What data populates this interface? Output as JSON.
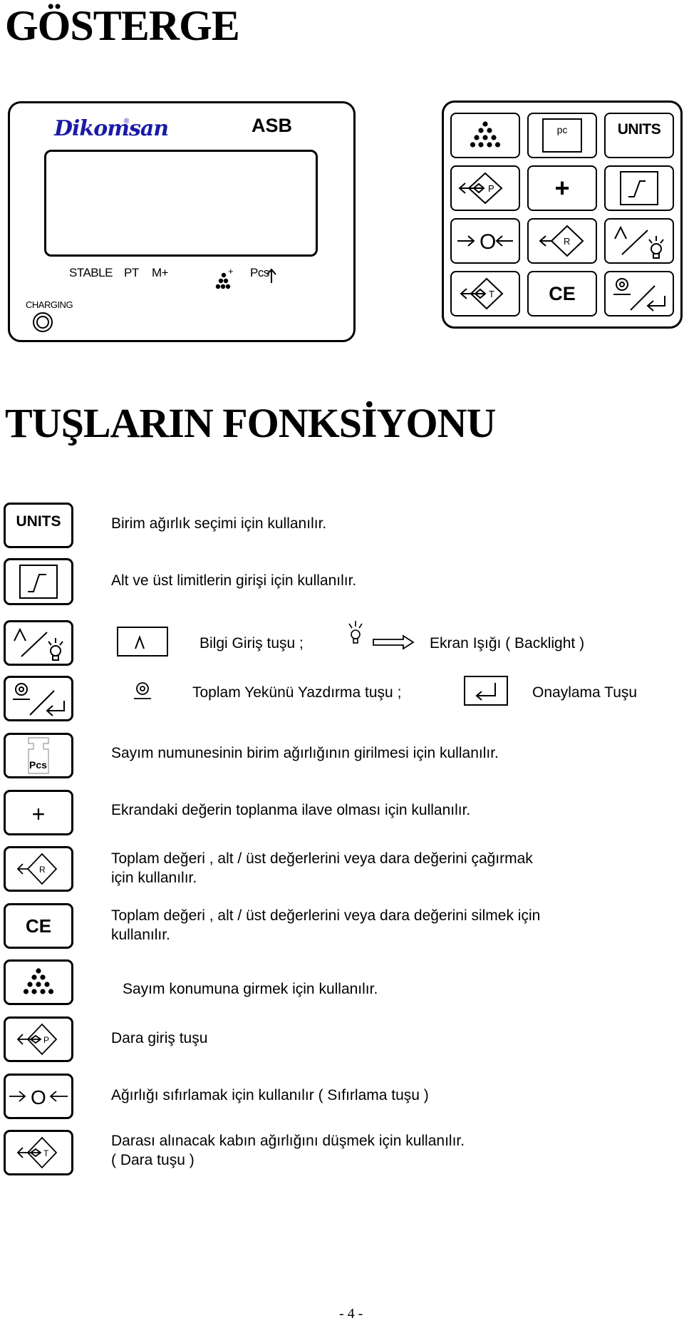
{
  "page": {
    "title": "GÖSTERGE",
    "section_title": "TUŞLARIN FONKSİYONU",
    "page_number": "- 4 -"
  },
  "device": {
    "brand": "Dikomsan",
    "brand_color": "#1a1aa8",
    "registered_mark": "®",
    "model": "ASB",
    "indicators": {
      "stable": "STABLE",
      "pt": "PT",
      "m_plus": "M+",
      "count_plus": "+",
      "pcs": "Pcs"
    },
    "charging_label": "CHARGING",
    "keypad": {
      "pc_label": "pc",
      "units_label": "UNITS",
      "plus_label": "+",
      "zero_label": "O",
      "recall_label": "R",
      "ce_label": "CE",
      "preset_label": "P",
      "tare_label": "T"
    }
  },
  "functions": [
    {
      "key": "units",
      "key_label": "UNITS",
      "text": "Birim ağırlık seçimi için kullanılır."
    },
    {
      "key": "limit",
      "text": "Alt ve üst limitlerin girişi için kullanılır."
    },
    {
      "key": "info-backlight",
      "info_text": "Bilgi Giriş tuşu ;",
      "backlight_text": "Ekran Işığı ( Backlight )"
    },
    {
      "key": "print-enter",
      "print_text": "Toplam Yekünü Yazdırma tuşu ;",
      "enter_text": "Onaylama Tuşu"
    },
    {
      "key": "pcs",
      "key_label": "Pcs",
      "text": "Sayım numunesinin birim ağırlığının girilmesi için kullanılır."
    },
    {
      "key": "plus",
      "key_label": "+",
      "text": "Ekrandaki değerin toplanma ilave olması için kullanılır."
    },
    {
      "key": "recall",
      "key_label": "R",
      "text_line1": "Toplam değeri , alt / üst değerlerini veya dara değerini çağırmak",
      "text_line2": "için kullanılır."
    },
    {
      "key": "ce",
      "key_label": "CE",
      "text_line1": "Toplam değeri , alt / üst değerlerini veya dara değerini silmek için",
      "text_line2": "kullanılır."
    },
    {
      "key": "count",
      "text": "Sayım konumuna girmek için kullanılır."
    },
    {
      "key": "preset-tare",
      "key_label": "P",
      "text": "Dara giriş tuşu"
    },
    {
      "key": "zero",
      "key_label": "O",
      "text": "Ağırlığı sıfırlamak için kullanılır ( Sıfırlama tuşu )"
    },
    {
      "key": "tare",
      "key_label": "T",
      "text_line1": "Darası alınacak kabın ağırlığını düşmek için kullanılır.",
      "text_line2": "( Dara tuşu )"
    }
  ]
}
